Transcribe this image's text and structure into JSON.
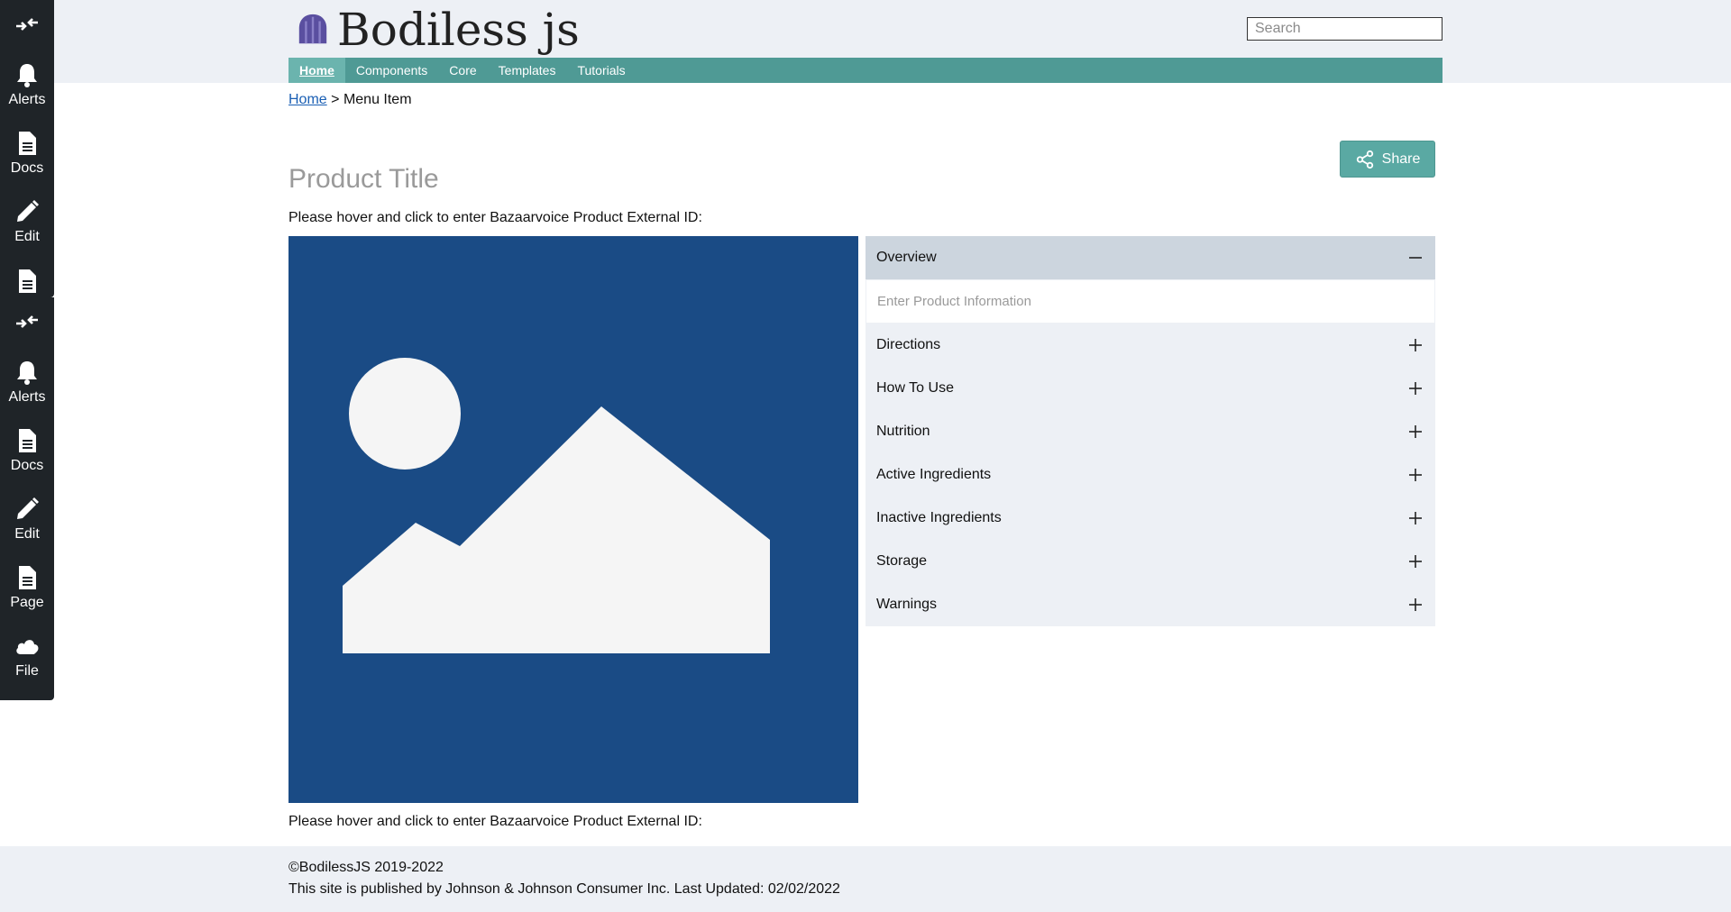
{
  "header": {
    "logo_text": "Bodiless js",
    "search_placeholder": "Search"
  },
  "nav": {
    "items": [
      {
        "label": "Home",
        "active": true
      },
      {
        "label": "Components"
      },
      {
        "label": "Core"
      },
      {
        "label": "Templates"
      },
      {
        "label": "Tutorials"
      }
    ]
  },
  "toolbar": {
    "group1": [
      {
        "icon": "collapse-arrows-icon",
        "label": ""
      },
      {
        "icon": "bell-icon",
        "label": "Alerts"
      },
      {
        "icon": "document-icon",
        "label": "Docs"
      },
      {
        "icon": "pencil-icon",
        "label": "Edit"
      },
      {
        "icon": "document-icon",
        "label": ""
      }
    ],
    "group2": [
      {
        "icon": "collapse-arrows-icon",
        "label": ""
      },
      {
        "icon": "bell-icon",
        "label": "Alerts"
      },
      {
        "icon": "document-icon",
        "label": "Docs"
      },
      {
        "icon": "pencil-icon",
        "label": "Edit"
      },
      {
        "icon": "document-icon",
        "label": "Page"
      },
      {
        "icon": "cloud-icon",
        "label": "File"
      }
    ]
  },
  "breadcrumb": {
    "home": "Home",
    "separator": ">",
    "current": "Menu Item"
  },
  "share_label": "Share",
  "product_title": "Product Title",
  "bv_note": "Please hover and click to enter Bazaarvoice Product External ID:",
  "accordion": {
    "open_section": {
      "label": "Overview",
      "placeholder": "Enter Product Information"
    },
    "sections": [
      {
        "label": "Directions"
      },
      {
        "label": "How To Use"
      },
      {
        "label": "Nutrition"
      },
      {
        "label": "Active Ingredients"
      },
      {
        "label": "Inactive Ingredients"
      },
      {
        "label": "Storage"
      },
      {
        "label": "Warnings"
      }
    ]
  },
  "footer": {
    "copyright": "©BodilessJS 2019-2022",
    "published": "This site is published by Johnson & Johnson Consumer Inc. Last Updated: 02/02/2022"
  },
  "colors": {
    "nav_bg": "#4f9a95",
    "image_bg": "#1a4b85",
    "share_bg": "#5aa9a3",
    "header_bg": "#edf0f5"
  }
}
